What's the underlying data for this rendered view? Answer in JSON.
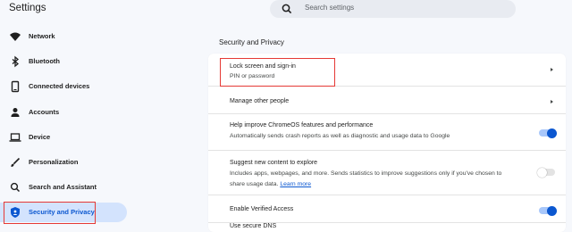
{
  "app": {
    "title": "Settings"
  },
  "search": {
    "placeholder": "Search settings"
  },
  "sidebar": {
    "items": [
      {
        "label": "Network",
        "icon": "wifi-icon"
      },
      {
        "label": "Bluetooth",
        "icon": "bluetooth-icon"
      },
      {
        "label": "Connected devices",
        "icon": "phone-icon"
      },
      {
        "label": "Accounts",
        "icon": "person-icon"
      },
      {
        "label": "Device",
        "icon": "laptop-icon"
      },
      {
        "label": "Personalization",
        "icon": "brush-icon"
      },
      {
        "label": "Search and Assistant",
        "icon": "search-icon"
      },
      {
        "label": "Security and Privacy",
        "icon": "shield-icon",
        "selected": true
      }
    ]
  },
  "main": {
    "section_title": "Security and Privacy",
    "rows": [
      {
        "title": "Lock screen and sign-in",
        "subtitle": "PIN or password",
        "control": "chevron"
      },
      {
        "title": "Manage other people",
        "control": "chevron"
      },
      {
        "title": "Help improve ChromeOS features and performance",
        "subtitle": "Automatically sends crash reports as well as diagnostic and usage data to Google",
        "control": "toggle",
        "enabled": true
      },
      {
        "title": "Suggest new content to explore",
        "subtitle": "Includes apps, webpages, and more. Sends statistics to improve suggestions only if you've chosen to",
        "subtitle2": "share usage data.",
        "link": "Learn more",
        "control": "toggle",
        "enabled": false
      },
      {
        "title": "Enable Verified Access",
        "control": "toggle",
        "enabled": true
      },
      {
        "title": "Use secure DNS"
      }
    ]
  },
  "colors": {
    "accent": "#0b57d0",
    "selected_bg": "#d3e3fd",
    "annotation_red": "#e53935"
  }
}
